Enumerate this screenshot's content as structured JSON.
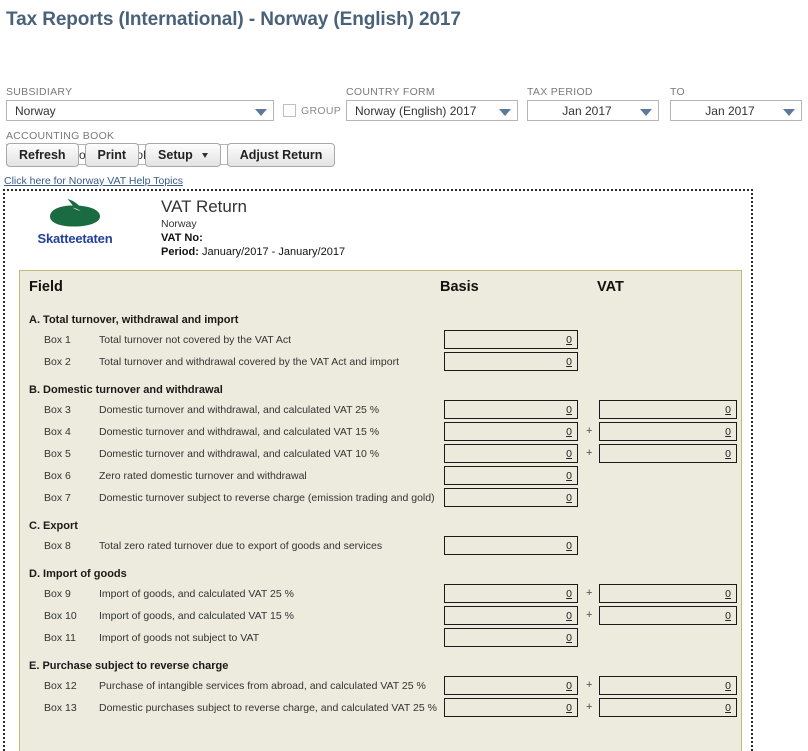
{
  "page": {
    "title": "Tax Reports (International) - Norway (English) 2017"
  },
  "filters": {
    "subsidiary": {
      "label": "SUBSIDIARY",
      "value": "Norway"
    },
    "group": {
      "label": "GROUP",
      "checked": false
    },
    "country_form": {
      "label": "COUNTRY FORM",
      "value": "Norway (English) 2017"
    },
    "tax_period": {
      "label": "TAX PERIOD",
      "value": "Jan 2017"
    },
    "to": {
      "label": "TO",
      "value": "Jan 2017"
    },
    "accounting_book": {
      "label": "ACCOUNTING BOOK",
      "value": "Primary Accounting Book"
    }
  },
  "toolbar": {
    "refresh": "Refresh",
    "print": "Print",
    "setup": "Setup",
    "adjust_return": "Adjust Return"
  },
  "help_link": "Click here for Norway VAT Help Topics",
  "report": {
    "logo_text": "Skatteetaten",
    "logo_color": "#1b6b42",
    "logo_text_color": "#24409a",
    "title": "VAT Return",
    "subtitle": "Norway",
    "vat_no_label": "VAT No:",
    "vat_no_value": "",
    "period_label": "Period:",
    "period_value": "January/2017 - January/2017"
  },
  "table": {
    "headers": {
      "field": "Field",
      "basis": "Basis",
      "vat": "VAT"
    },
    "sections": [
      {
        "title": "A. Total turnover, withdrawal and import",
        "rows": [
          {
            "box": "Box 1",
            "desc": "Total turnover not covered by the VAT Act",
            "basis": "0",
            "vat": null,
            "plus": false
          },
          {
            "box": "Box 2",
            "desc": "Total turnover and withdrawal covered by the VAT Act and import",
            "basis": "0",
            "vat": null,
            "plus": false
          }
        ]
      },
      {
        "title": "B. Domestic turnover and withdrawal",
        "rows": [
          {
            "box": "Box 3",
            "desc": "Domestic turnover and withdrawal, and calculated VAT 25 %",
            "basis": "0",
            "vat": "0",
            "plus": false
          },
          {
            "box": "Box 4",
            "desc": "Domestic turnover and withdrawal, and calculated VAT 15 %",
            "basis": "0",
            "vat": "0",
            "plus": true
          },
          {
            "box": "Box 5",
            "desc": "Domestic turnover and withdrawal, and calculated VAT 10 %",
            "basis": "0",
            "vat": "0",
            "plus": true
          },
          {
            "box": "Box 6",
            "desc": "Zero rated domestic turnover and withdrawal",
            "basis": "0",
            "vat": null,
            "plus": false
          },
          {
            "box": "Box 7",
            "desc": "Domestic turnover subject to reverse charge (emission trading and gold)",
            "basis": "0",
            "vat": null,
            "plus": false
          }
        ]
      },
      {
        "title": "C. Export",
        "rows": [
          {
            "box": "Box 8",
            "desc": "Total zero rated turnover due to export of goods and services",
            "basis": "0",
            "vat": null,
            "plus": false
          }
        ]
      },
      {
        "title": "D. Import of goods",
        "rows": [
          {
            "box": "Box 9",
            "desc": "Import of goods, and calculated VAT 25 %",
            "basis": "0",
            "vat": "0",
            "plus": true
          },
          {
            "box": "Box 10",
            "desc": "Import of goods, and calculated VAT 15 %",
            "basis": "0",
            "vat": "0",
            "plus": true
          },
          {
            "box": "Box 11",
            "desc": "Import of goods not subject to VAT",
            "basis": "0",
            "vat": null,
            "plus": false
          }
        ]
      },
      {
        "title": "E. Purchase subject to reverse charge",
        "rows": [
          {
            "box": "Box 12",
            "desc": "Purchase of intangible services from abroad, and calculated VAT 25 %",
            "basis": "0",
            "vat": "0",
            "plus": true
          },
          {
            "box": "Box 13",
            "desc": "Domestic purchases subject to reverse charge, and calculated VAT 25 %",
            "basis": "0",
            "vat": "0",
            "plus": true
          }
        ]
      }
    ]
  }
}
